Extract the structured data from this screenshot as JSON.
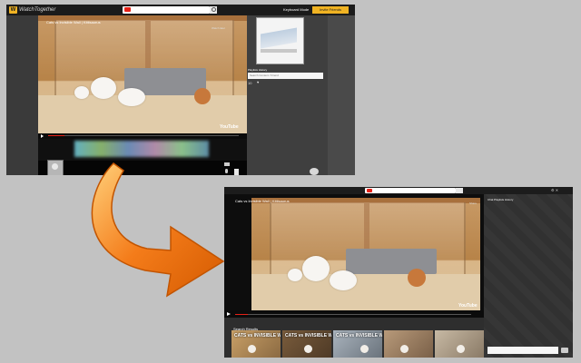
{
  "before": {
    "logo_text": "WatchTogether",
    "top_link": "Keyboard Mode",
    "top_cta": "Invite Friends",
    "video_title": "Cats vs Invisible Wall | Kittisaurus",
    "watermark": "YouTube",
    "sidebar_tabs": "Playlists   History",
    "sidebar_input_placeholder": "Search Content / Friend",
    "sidebar_count": "10",
    "tools_text": "Watch later"
  },
  "after": {
    "video_title": "Cats vs Invisible Wall | Kittisaurus",
    "watermark": "YouTube",
    "tools_text": "Share",
    "sidebar_tabs": "Chat   Playlists   History",
    "search_results_label": "Search Results",
    "results": [
      {
        "title": "CATS vs INVISIBLE WALL",
        "color_a": "#c9a067",
        "color_b": "#8b6a42"
      },
      {
        "title": "CATS vs INVISIBLE WALL",
        "color_a": "#7a5c3c",
        "color_b": "#4e3a26"
      },
      {
        "title": "CATS vs INVISIBLE WALL",
        "color_a": "#aab4be",
        "color_b": "#6a737c"
      },
      {
        "title": "",
        "color_a": "#b89a7a",
        "color_b": "#7a6048"
      },
      {
        "title": "",
        "color_a": "#c7b9a4",
        "color_b": "#8a7a66"
      }
    ]
  },
  "colors": {
    "arrow_orange": "#f47c1a",
    "accent_yellow": "#f0b323",
    "youtube_red": "#e62117"
  }
}
